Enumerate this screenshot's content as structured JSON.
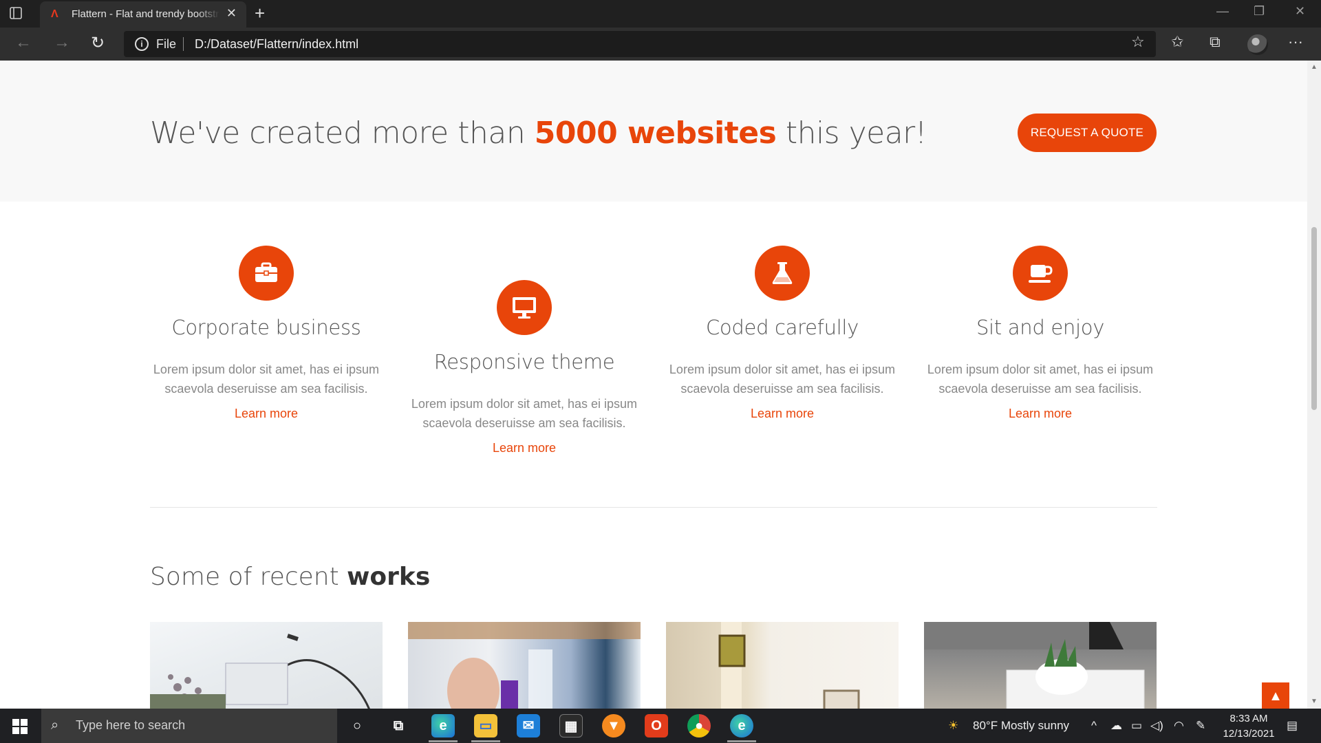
{
  "browser": {
    "tab_title": "Flattern - Flat and trendy bootstrap template",
    "tab_favicon": "Λ",
    "close_tab": "✕",
    "new_tab": "+",
    "address_prefix": "File",
    "url": "D:/Dataset/Flattern/index.html",
    "window_controls": {
      "minimize": "—",
      "restore": "❐",
      "close": "✕"
    },
    "nav": {
      "back": "←",
      "forward": "→",
      "refresh": "↻"
    },
    "toolbar_icons": {
      "add_favorite": "☆",
      "favorites": "✩",
      "collections": "⧉",
      "menu": "···"
    }
  },
  "callout": {
    "text_before": "We've created more than ",
    "highlight": "5000 websites",
    "text_after": " this year!",
    "button_label": "REQUEST A QUOTE"
  },
  "features": [
    {
      "title": "Corporate business",
      "description": "Lorem ipsum dolor sit amet, has ei ipsum scaevola deseruisse am sea facilisis.",
      "link": "Learn more",
      "icon": "briefcase-icon"
    },
    {
      "title": "Responsive theme",
      "description": "Lorem ipsum dolor sit amet, has ei ipsum scaevola deseruisse am sea facilisis.",
      "link": "Learn more",
      "icon": "desktop-icon"
    },
    {
      "title": "Coded carefully",
      "description": "Lorem ipsum dolor sit amet, has ei ipsum scaevola deseruisse am sea facilisis.",
      "link": "Learn more",
      "icon": "flask-icon"
    },
    {
      "title": "Sit and enjoy",
      "description": "Lorem ipsum dolor sit amet, has ei ipsum scaevola deseruisse am sea facilisis.",
      "link": "Learn more",
      "icon": "coffee-icon"
    }
  ],
  "works": {
    "heading_light": "Some of recent ",
    "heading_bold": "works"
  },
  "back_to_top": "▲",
  "taskbar": {
    "search_placeholder": "Type here to search",
    "weather": "80°F  Mostly sunny",
    "time": "8:33 AM",
    "date": "12/13/2021"
  },
  "colors": {
    "accent": "#e8450a",
    "text": "#555555",
    "muted": "#888888"
  }
}
